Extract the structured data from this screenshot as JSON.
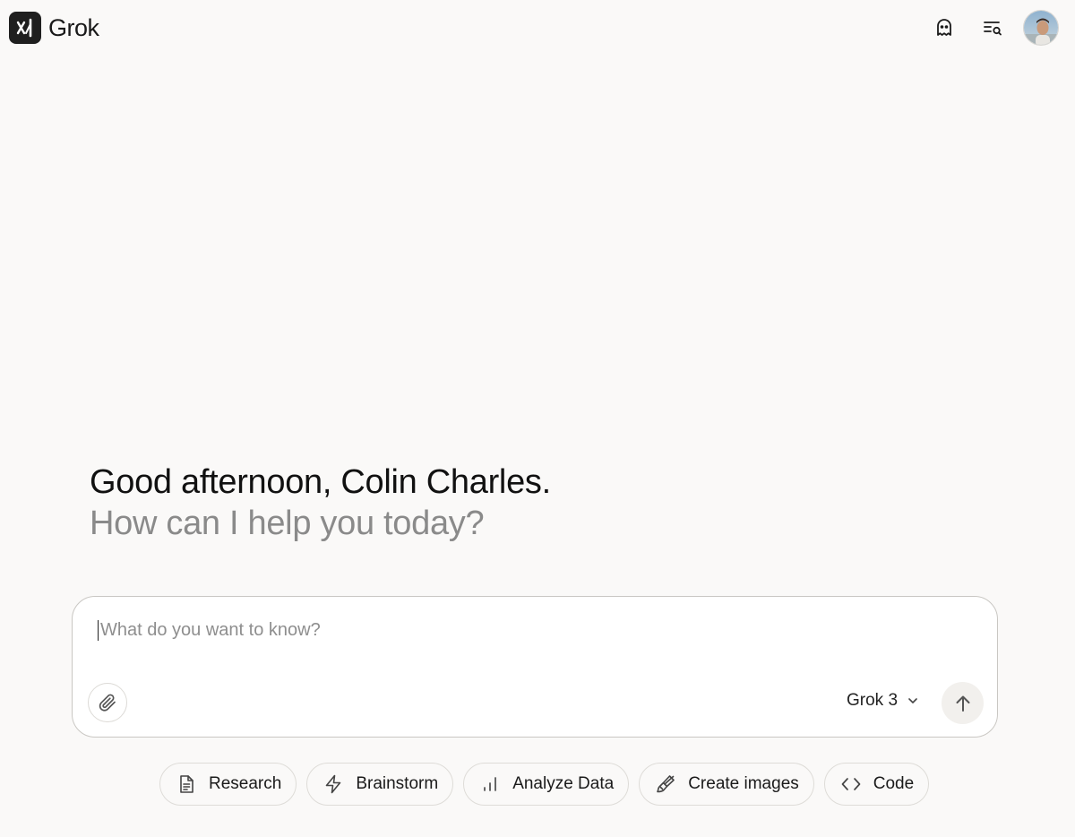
{
  "app": {
    "name": "Grok"
  },
  "header": {
    "icons": [
      "ghost-icon",
      "search-history-icon"
    ],
    "avatar_alt": "user-avatar"
  },
  "greeting": {
    "line1": "Good afternoon, Colin Charles.",
    "line2": "How can I help you today?"
  },
  "composer": {
    "placeholder": "What do you want to know?",
    "value": "",
    "model": "Grok 3"
  },
  "chips": [
    {
      "label": "Research",
      "icon": "document-icon"
    },
    {
      "label": "Brainstorm",
      "icon": "lightning-icon"
    },
    {
      "label": "Analyze Data",
      "icon": "bar-chart-icon"
    },
    {
      "label": "Create images",
      "icon": "paintbrush-icon"
    },
    {
      "label": "Code",
      "icon": "code-icon"
    }
  ],
  "colors": {
    "background": "#faf9f8",
    "text_primary": "#111111",
    "text_secondary": "#8a8a8a",
    "border": "#c9c7c3"
  }
}
